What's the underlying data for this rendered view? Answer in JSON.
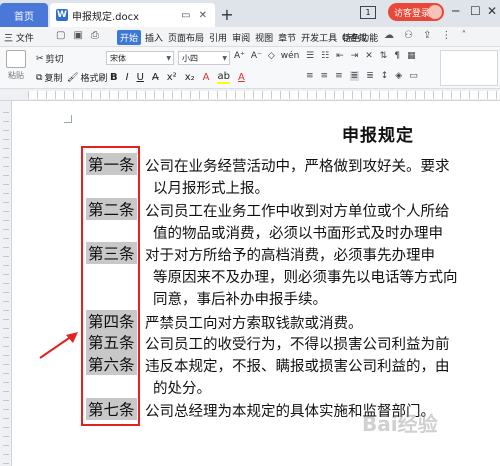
{
  "titlebar": {
    "home_tab": "首页",
    "doc_tab": "申报规定.docx",
    "doc_icon": "W",
    "new_tab": "+",
    "window_count": "1",
    "login": "访客登录"
  },
  "menubar": {
    "file": "三 文件",
    "tabs": [
      "开始",
      "插入",
      "页面布局",
      "引用",
      "审阅",
      "视图",
      "章节",
      "开发工具",
      "特色功能"
    ],
    "search": "Q查找"
  },
  "ribbon": {
    "paste": "粘贴",
    "cut": "剪切",
    "copy": "复制",
    "format_painter": "格式刷",
    "font": "宋体",
    "font_size": "小四"
  },
  "document": {
    "title": "申报规定",
    "articles": [
      {
        "label": "第一条",
        "lines": [
          "公司在业务经营活动中，严格做到攻好关。要求",
          "以月报形式上报。"
        ]
      },
      {
        "label": "第二条",
        "lines": [
          "公司员工在业务工作中收到对方单位或个人所给",
          "值的物品或消费，必须以书面形式及时办理申"
        ]
      },
      {
        "label": "第三条",
        "lines": [
          "对于对方所给予的高档消费，必须事先办理申",
          "等原因来不及办理，则必须事先以电话等方式向",
          "同意，事后补办申报手续。"
        ]
      },
      {
        "label": "第四条",
        "lines": [
          "严禁员工向对方索取钱款或消费。"
        ]
      },
      {
        "label": "第五条",
        "lines": [
          "公司员工的收受行为，不得以损害公司利益为前"
        ]
      },
      {
        "label": "第六条",
        "lines": [
          "违反本规定，不报、瞒报或损害公司利益的，由",
          "的处分。"
        ]
      },
      {
        "label": "第七条",
        "lines": [
          "公司总经理为本规定的具体实施和监督部门。"
        ]
      }
    ]
  },
  "watermark": "Bai经验",
  "colors": {
    "accent": "#3c78d8",
    "highlight": "#c8c8c8",
    "annotation_red": "#e32222"
  }
}
